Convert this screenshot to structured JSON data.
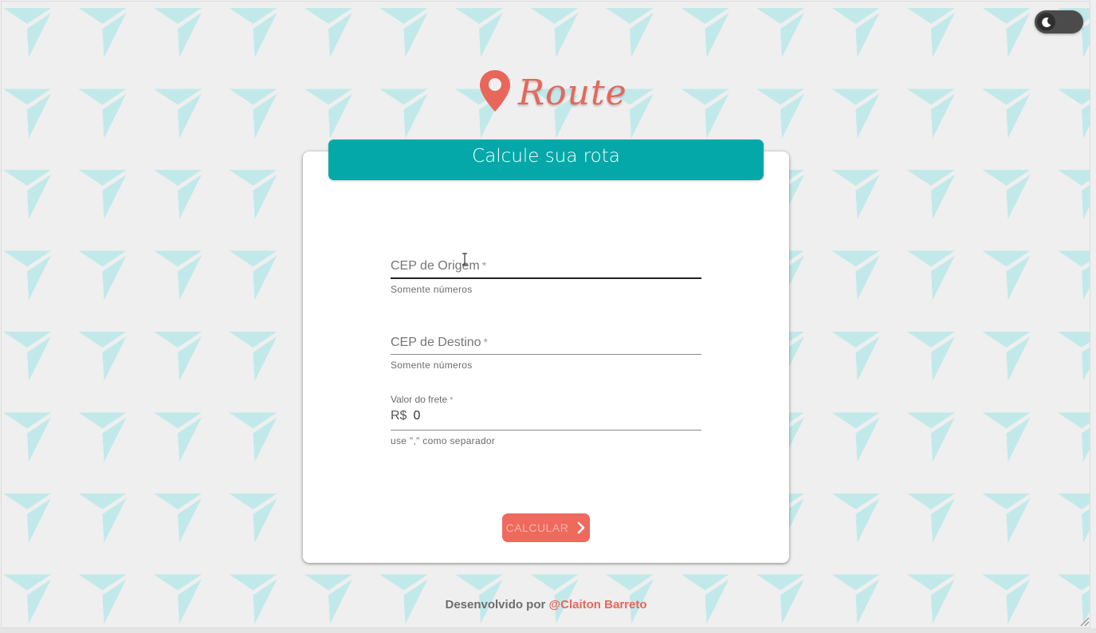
{
  "app": {
    "logo_text": "Route",
    "brand_color": "#e8665a",
    "accent_color": "#04a8a8",
    "theme_toggle": {
      "icon": "moon-icon",
      "mode": "light"
    }
  },
  "card": {
    "title": "Calcule sua rota",
    "fields": {
      "origin": {
        "label": "CEP de Origem",
        "required_mark": "*",
        "helper": "Somente números",
        "value": ""
      },
      "destination": {
        "label": "CEP de Destino",
        "required_mark": "*",
        "helper": "Somente números",
        "value": ""
      },
      "freight": {
        "label": "Valor do frete",
        "required_mark": "*",
        "prefix": "R$",
        "value": "0",
        "helper": "use \",\" como separador"
      }
    },
    "submit_label": "CALCULAR",
    "submit_icon": "chevron-right-icon"
  },
  "footer": {
    "prefix": "Desenvolvido por",
    "author": "@Claiton Barreto"
  }
}
